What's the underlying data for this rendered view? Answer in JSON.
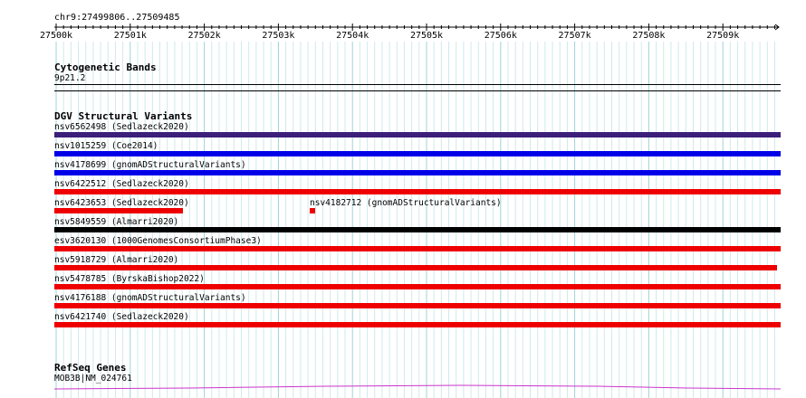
{
  "ruler": {
    "location": "chr9:27499806..27509485",
    "ticks": [
      "27500k",
      "27501k",
      "27502k",
      "27503k",
      "27504k",
      "27505k",
      "27506k",
      "27507k",
      "27508k",
      "27509k"
    ]
  },
  "cytoband_track": {
    "title": "Cytogenetic Bands",
    "band": "9p21.2"
  },
  "dgv_track": {
    "title": "DGV Structural Variants",
    "features": [
      {
        "label": "nsv6562498 (Sedlazeck2020)",
        "color": "#3b1f7a"
      },
      {
        "label": "nsv1015259 (Coe2014)",
        "color": "#0000e8"
      },
      {
        "label": "nsv4178699 (gnomADStructuralVariants)",
        "color": "#0000e8"
      },
      {
        "label": "nsv6422512 (Sedlazeck2020)",
        "color": "#ee0000"
      },
      {
        "label": "nsv6423653 (Sedlazeck2020)",
        "color": "#ee0000"
      },
      {
        "label": "nsv4182712 (gnomADStructuralVariants)",
        "color": "#ee0000"
      },
      {
        "label": "nsv5849559 (Almarri2020)",
        "color": "#000000"
      },
      {
        "label": "esv3620130 (1000GenomesConsortiumPhase3)",
        "color": "#ee0000"
      },
      {
        "label": "nsv5918729 (Almarri2020)",
        "color": "#ee0000"
      },
      {
        "label": "nsv5478785 (ByrskaBishop2022)",
        "color": "#ee0000"
      },
      {
        "label": "nsv4176188 (gnomADStructuralVariants)",
        "color": "#ee0000"
      },
      {
        "label": "nsv6421740 (Sedlazeck2020)",
        "color": "#ee0000"
      }
    ]
  },
  "refseq_track": {
    "title": "RefSeq Genes",
    "gene": "MOB3B|NM_024761",
    "color": "#cc33cc"
  }
}
